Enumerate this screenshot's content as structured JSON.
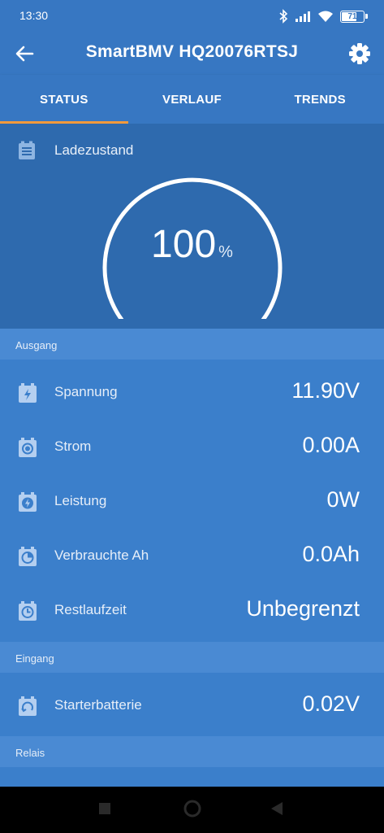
{
  "status_bar": {
    "time": "13:30",
    "battery_level": "71"
  },
  "app_bar": {
    "title": "SmartBMV HQ20076RTSJ"
  },
  "tabs": [
    {
      "label": "STATUS",
      "active": true
    },
    {
      "label": "VERLAUF",
      "active": false
    },
    {
      "label": "TRENDS",
      "active": false
    }
  ],
  "soc": {
    "label": "Ladezustand",
    "value": "100",
    "unit": "%",
    "fraction": 1.0
  },
  "sections": {
    "ausgang": "Ausgang",
    "eingang": "Eingang",
    "relais": "Relais"
  },
  "rows": {
    "spannung": {
      "label": "Spannung",
      "value": "11.90V"
    },
    "strom": {
      "label": "Strom",
      "value": "0.00A"
    },
    "leistung": {
      "label": "Leistung",
      "value": "0W"
    },
    "verbrauchte": {
      "label": "Verbrauchte Ah",
      "value": "0.0Ah"
    },
    "restlaufzeit": {
      "label": "Restlaufzeit",
      "value": "Unbegrenzt"
    },
    "starterbatterie": {
      "label": "Starterbatterie",
      "value": "0.02V"
    }
  },
  "colors": {
    "accent": "#f39a3c",
    "primary": "#3777c2"
  }
}
